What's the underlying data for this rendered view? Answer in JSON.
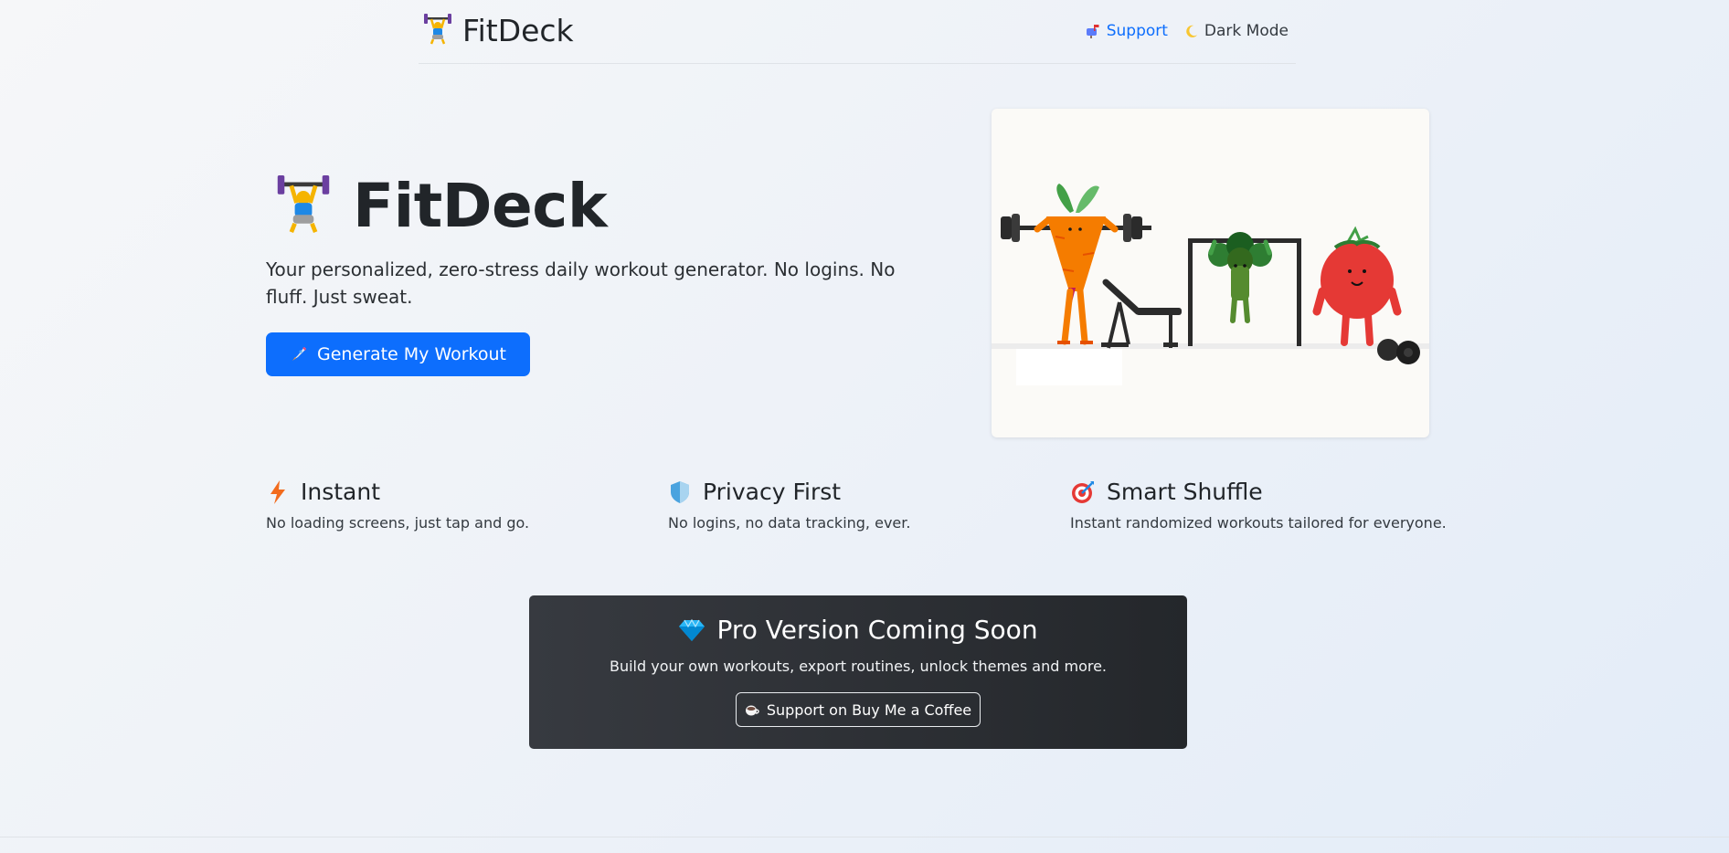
{
  "navbar": {
    "brand_icon": "weightlifter-icon",
    "brand": "FitDeck",
    "support_icon": "mailbox-icon",
    "support": "Support",
    "dark_mode_icon": "crescent-moon-icon",
    "dark_mode": "Dark Mode"
  },
  "hero": {
    "icon": "weightlifter-icon",
    "title": "FitDeck",
    "description": "Your personalized, zero-stress daily workout generator. No logins. No fluff. Just sweat.",
    "cta_icon": "rocket-icon",
    "cta": "Generate My Workout",
    "illustration": "gym-vegetables-illustration"
  },
  "features": [
    {
      "icon": "lightning-icon",
      "title": "Instant",
      "description": "No loading screens, just tap and go."
    },
    {
      "icon": "shield-icon",
      "title": "Privacy First",
      "description": "No logins, no data tracking, ever."
    },
    {
      "icon": "target-icon",
      "title": "Smart Shuffle",
      "description": "Instant randomized workouts tailored for everyone."
    }
  ],
  "pro": {
    "icon": "gem-icon",
    "title": "Pro Version Coming Soon",
    "description": "Build your own workouts, export routines, unlock themes and more.",
    "button_icon": "coffee-icon",
    "button": "Support on Buy Me a Coffee"
  },
  "colors": {
    "primary": "#0d6efd",
    "text": "#212529",
    "pro_bg": "#2b2e33"
  }
}
